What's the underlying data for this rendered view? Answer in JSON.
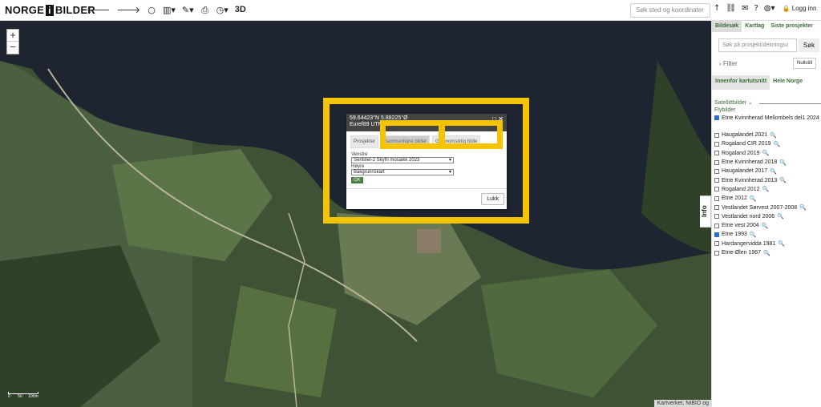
{
  "topbar": {
    "logo_left": "NORGE",
    "logo_mid": "i",
    "logo_right": "BILDER",
    "search_placeholder": "Søk sted og koordinater",
    "login": "Logg inn",
    "tool_3d": "3D"
  },
  "map": {
    "zoom_in": "+",
    "zoom_out": "−",
    "info_tab": "Info",
    "attribution": "Kartverket, NIBIO og",
    "scale_labels": [
      "0",
      "50",
      "100m"
    ]
  },
  "popup": {
    "coords": "59.64423°N 5.88225°Ø",
    "projection": "Euref89 UTM",
    "tabs": [
      "Prosjekter",
      "Sammenligne bilder",
      "Gjennomsiktig bilde"
    ],
    "venstre_label": "Venstre",
    "venstre_value": "Sentinel-2 Skyfri mosaikk 2023",
    "hoyre_label": "Høyre",
    "hoyre_value": "Bakgrunnskart",
    "ok": "OK",
    "close": "Lukk"
  },
  "sidebar": {
    "tabs": [
      "Bildesøk",
      "Kartlag",
      "Siste prosjekter"
    ],
    "search_placeholder": "Søk på prosjekt/dekningsv",
    "search_button": "Søk",
    "filter": "Filter",
    "reset": "Nullstill",
    "subtabs": [
      "Innenfor kartutsnitt",
      "Hele Norge"
    ],
    "satellite_header": "Satellittbilder",
    "flybilder_header": "Flybilder",
    "items": [
      {
        "label": "Etne Kvinnherad Mellombels del1 2024",
        "checked": true
      },
      {
        "label": "Haugalandet 2021",
        "checked": false
      },
      {
        "label": "Rogaland CIR 2019",
        "checked": false
      },
      {
        "label": "Rogaland 2019",
        "checked": false
      },
      {
        "label": "Etne Kvinnherad 2018",
        "checked": false
      },
      {
        "label": "Haugalandet 2017",
        "checked": false
      },
      {
        "label": "Etne Kvinnherad 2013",
        "checked": false
      },
      {
        "label": "Rogaland 2012",
        "checked": false
      },
      {
        "label": "Etne 2012",
        "checked": false
      },
      {
        "label": "Vestlandet Sørvest 2007-2008",
        "checked": false
      },
      {
        "label": "Vestlandet nord 2006",
        "checked": false
      },
      {
        "label": "Etne vest 2004",
        "checked": false
      },
      {
        "label": "Etne 1993",
        "checked": true
      },
      {
        "label": "Hardangervidda 1981",
        "checked": false
      },
      {
        "label": "Etne-Ølen 1967",
        "checked": false
      }
    ]
  }
}
